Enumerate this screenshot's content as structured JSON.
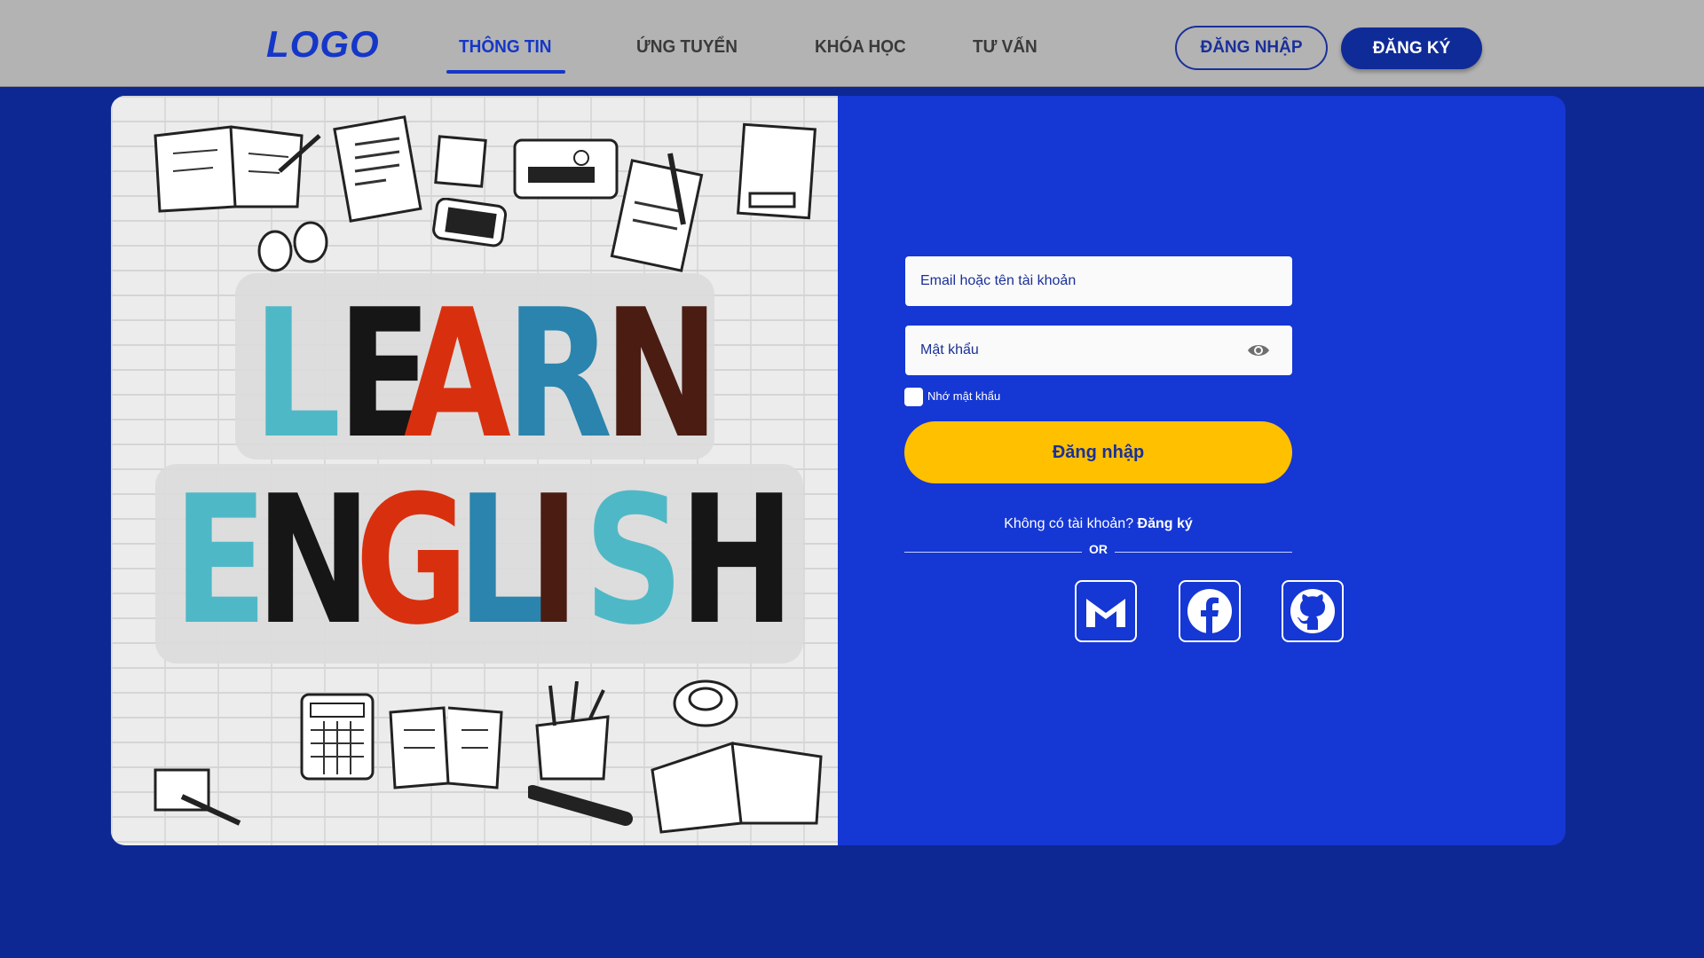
{
  "header": {
    "logo": "LOGO",
    "nav": [
      {
        "label": "THÔNG TIN",
        "active": true
      },
      {
        "label": "ỨNG TUYỂN",
        "active": false
      },
      {
        "label": "KHÓA HỌC",
        "active": false
      },
      {
        "label": "TƯ VẤN",
        "active": false
      }
    ],
    "login_label": "ĐĂNG NHẬP",
    "register_label": "ĐĂNG KÝ"
  },
  "hero": {
    "line1": [
      "L",
      "E",
      "A",
      "R",
      "N"
    ],
    "line2": [
      "E",
      "N",
      "G",
      "L",
      "I",
      "S",
      "H"
    ]
  },
  "form": {
    "email_placeholder": "Email hoặc tên tài khoản",
    "password_placeholder": "Mật khẩu",
    "remember_label": "Nhớ mật khẩu",
    "submit_label": "Đăng nhập",
    "no_account_text": "Không có tài khoản?",
    "signup_link": "Đăng ký",
    "or_text": "OR"
  },
  "social": [
    "gmail-icon",
    "facebook-icon",
    "github-icon"
  ],
  "colors": {
    "primary": "#1537d4",
    "background": "#0d2893",
    "header": "#b3b3b3",
    "accent": "#ffc000",
    "letters": [
      "#4fb8c6",
      "#161616",
      "#d8300f",
      "#2a84ad",
      "#4a1c12"
    ]
  }
}
